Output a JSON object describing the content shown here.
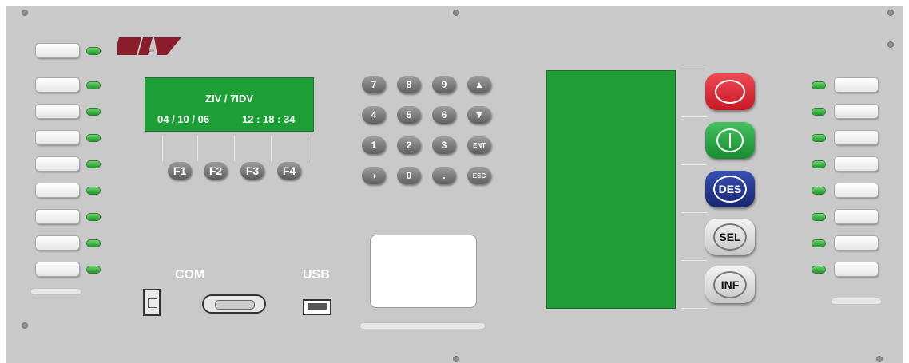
{
  "brand": {
    "logo_text": "ZIV",
    "color": "#8a1c2b"
  },
  "lcd": {
    "model": "ZIV / 7IDV",
    "date": "04 / 10 / 06",
    "time": "12 : 18 : 34"
  },
  "function_keys": [
    "F1",
    "F2",
    "F3",
    "F4"
  ],
  "keypad": [
    [
      "7",
      "8",
      "9",
      "▲"
    ],
    [
      "4",
      "5",
      "6",
      "▼"
    ],
    [
      "1",
      "2",
      "3",
      "ENT"
    ],
    [
      "◑",
      "0",
      ".",
      "ESC"
    ]
  ],
  "control_buttons": [
    {
      "label": "O",
      "color": "#d8202c",
      "name": "open-button"
    },
    {
      "label": "|",
      "color": "#21a03a",
      "name": "close-button"
    },
    {
      "label": "DES",
      "color": "#1f2f86",
      "name": "des-button"
    },
    {
      "label": "SEL",
      "color": "#e8e8e8",
      "name": "sel-button"
    },
    {
      "label": "INF",
      "color": "#e8e8e8",
      "name": "inf-button"
    }
  ],
  "ports": {
    "com_label": "COM",
    "usb_label": "USB"
  }
}
